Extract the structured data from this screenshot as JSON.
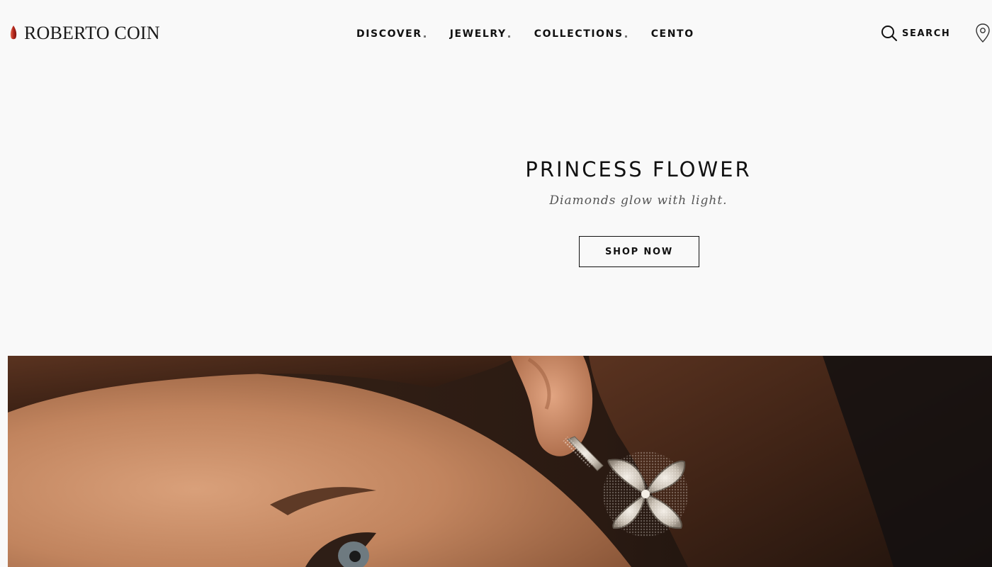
{
  "brand": {
    "name": "ROBERTO COIN"
  },
  "nav": {
    "items": [
      {
        "label": "DISCOVER",
        "has_dropdown": true
      },
      {
        "label": "JEWELRY",
        "has_dropdown": true
      },
      {
        "label": "COLLECTIONS",
        "has_dropdown": true
      },
      {
        "label": "CENTO",
        "has_dropdown": false
      }
    ]
  },
  "header": {
    "search_label": "SEARCH",
    "search_icon": "search-icon",
    "location_icon": "location-pin-icon"
  },
  "hero": {
    "title": "PRINCESS FLOWER",
    "subtitle": "Diamonds glow with light.",
    "cta_label": "SHOP NOW"
  },
  "colors": {
    "background": "#f9f9f9",
    "text": "#111111",
    "logo_accent": "#c0392b"
  }
}
